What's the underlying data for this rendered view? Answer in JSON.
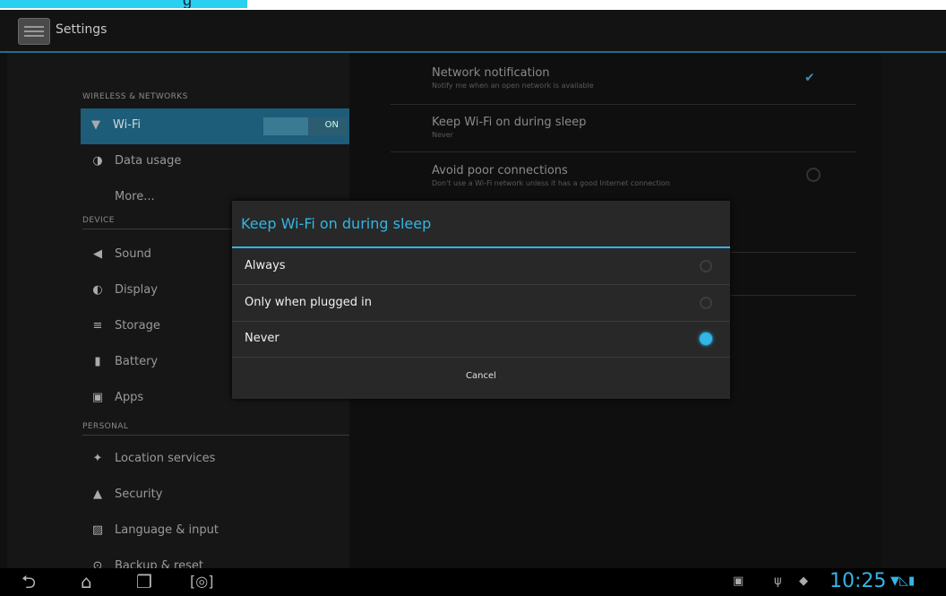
{
  "top_strip": {
    "text": "g"
  },
  "actionbar": {
    "title": "Settings"
  },
  "sidebar": {
    "sections": [
      {
        "header": "WIRELESS & NETWORKS"
      },
      {
        "header": "DEVICE"
      },
      {
        "header": "PERSONAL"
      }
    ],
    "items": [
      {
        "label": "Wi-Fi",
        "icon": "wifi-icon",
        "selected": true
      },
      {
        "label": "Data usage",
        "icon": "data-usage-icon"
      },
      {
        "label": "More..."
      },
      {
        "label": "Sound",
        "icon": "speaker-icon"
      },
      {
        "label": "Display",
        "icon": "display-icon"
      },
      {
        "label": "Storage",
        "icon": "storage-icon"
      },
      {
        "label": "Battery",
        "icon": "battery-icon"
      },
      {
        "label": "Apps",
        "icon": "apps-icon"
      },
      {
        "label": "Location services",
        "icon": "location-icon"
      },
      {
        "label": "Security",
        "icon": "lock-icon"
      },
      {
        "label": "Language & input",
        "icon": "language-icon"
      },
      {
        "label": "Backup & reset",
        "icon": "backup-icon"
      }
    ],
    "wifi_toggle": "ON"
  },
  "wifi_settings": {
    "items": [
      {
        "title": "Network notification",
        "subtitle": "Notify me when an open network is available"
      },
      {
        "title": "Keep Wi-Fi on during sleep",
        "subtitle": "Never"
      },
      {
        "title": "Avoid poor connections",
        "subtitle": "Don't use a Wi-Fi network unless it has a good Internet connection"
      }
    ]
  },
  "dialog": {
    "title": "Keep Wi-Fi on during sleep",
    "options": [
      {
        "label": "Always",
        "selected": false
      },
      {
        "label": "Only when plugged in",
        "selected": false
      },
      {
        "label": "Never",
        "selected": true
      }
    ],
    "cancel": "Cancel",
    "accent_color": "#33b5e5"
  },
  "status_bar": {
    "time": "10:25"
  }
}
